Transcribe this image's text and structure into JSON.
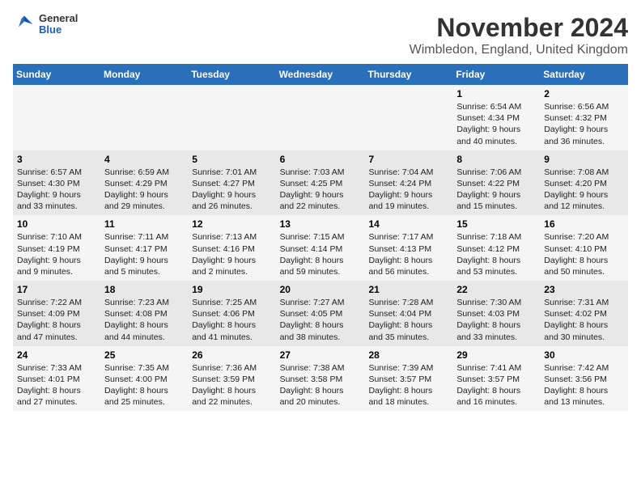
{
  "header": {
    "logo_general": "General",
    "logo_blue": "Blue",
    "title": "November 2024",
    "location": "Wimbledon, England, United Kingdom"
  },
  "weekdays": [
    "Sunday",
    "Monday",
    "Tuesday",
    "Wednesday",
    "Thursday",
    "Friday",
    "Saturday"
  ],
  "weeks": [
    [
      {
        "day": "",
        "info": ""
      },
      {
        "day": "",
        "info": ""
      },
      {
        "day": "",
        "info": ""
      },
      {
        "day": "",
        "info": ""
      },
      {
        "day": "",
        "info": ""
      },
      {
        "day": "1",
        "info": "Sunrise: 6:54 AM\nSunset: 4:34 PM\nDaylight: 9 hours\nand 40 minutes."
      },
      {
        "day": "2",
        "info": "Sunrise: 6:56 AM\nSunset: 4:32 PM\nDaylight: 9 hours\nand 36 minutes."
      }
    ],
    [
      {
        "day": "3",
        "info": "Sunrise: 6:57 AM\nSunset: 4:30 PM\nDaylight: 9 hours\nand 33 minutes."
      },
      {
        "day": "4",
        "info": "Sunrise: 6:59 AM\nSunset: 4:29 PM\nDaylight: 9 hours\nand 29 minutes."
      },
      {
        "day": "5",
        "info": "Sunrise: 7:01 AM\nSunset: 4:27 PM\nDaylight: 9 hours\nand 26 minutes."
      },
      {
        "day": "6",
        "info": "Sunrise: 7:03 AM\nSunset: 4:25 PM\nDaylight: 9 hours\nand 22 minutes."
      },
      {
        "day": "7",
        "info": "Sunrise: 7:04 AM\nSunset: 4:24 PM\nDaylight: 9 hours\nand 19 minutes."
      },
      {
        "day": "8",
        "info": "Sunrise: 7:06 AM\nSunset: 4:22 PM\nDaylight: 9 hours\nand 15 minutes."
      },
      {
        "day": "9",
        "info": "Sunrise: 7:08 AM\nSunset: 4:20 PM\nDaylight: 9 hours\nand 12 minutes."
      }
    ],
    [
      {
        "day": "10",
        "info": "Sunrise: 7:10 AM\nSunset: 4:19 PM\nDaylight: 9 hours\nand 9 minutes."
      },
      {
        "day": "11",
        "info": "Sunrise: 7:11 AM\nSunset: 4:17 PM\nDaylight: 9 hours\nand 5 minutes."
      },
      {
        "day": "12",
        "info": "Sunrise: 7:13 AM\nSunset: 4:16 PM\nDaylight: 9 hours\nand 2 minutes."
      },
      {
        "day": "13",
        "info": "Sunrise: 7:15 AM\nSunset: 4:14 PM\nDaylight: 8 hours\nand 59 minutes."
      },
      {
        "day": "14",
        "info": "Sunrise: 7:17 AM\nSunset: 4:13 PM\nDaylight: 8 hours\nand 56 minutes."
      },
      {
        "day": "15",
        "info": "Sunrise: 7:18 AM\nSunset: 4:12 PM\nDaylight: 8 hours\nand 53 minutes."
      },
      {
        "day": "16",
        "info": "Sunrise: 7:20 AM\nSunset: 4:10 PM\nDaylight: 8 hours\nand 50 minutes."
      }
    ],
    [
      {
        "day": "17",
        "info": "Sunrise: 7:22 AM\nSunset: 4:09 PM\nDaylight: 8 hours\nand 47 minutes."
      },
      {
        "day": "18",
        "info": "Sunrise: 7:23 AM\nSunset: 4:08 PM\nDaylight: 8 hours\nand 44 minutes."
      },
      {
        "day": "19",
        "info": "Sunrise: 7:25 AM\nSunset: 4:06 PM\nDaylight: 8 hours\nand 41 minutes."
      },
      {
        "day": "20",
        "info": "Sunrise: 7:27 AM\nSunset: 4:05 PM\nDaylight: 8 hours\nand 38 minutes."
      },
      {
        "day": "21",
        "info": "Sunrise: 7:28 AM\nSunset: 4:04 PM\nDaylight: 8 hours\nand 35 minutes."
      },
      {
        "day": "22",
        "info": "Sunrise: 7:30 AM\nSunset: 4:03 PM\nDaylight: 8 hours\nand 33 minutes."
      },
      {
        "day": "23",
        "info": "Sunrise: 7:31 AM\nSunset: 4:02 PM\nDaylight: 8 hours\nand 30 minutes."
      }
    ],
    [
      {
        "day": "24",
        "info": "Sunrise: 7:33 AM\nSunset: 4:01 PM\nDaylight: 8 hours\nand 27 minutes."
      },
      {
        "day": "25",
        "info": "Sunrise: 7:35 AM\nSunset: 4:00 PM\nDaylight: 8 hours\nand 25 minutes."
      },
      {
        "day": "26",
        "info": "Sunrise: 7:36 AM\nSunset: 3:59 PM\nDaylight: 8 hours\nand 22 minutes."
      },
      {
        "day": "27",
        "info": "Sunrise: 7:38 AM\nSunset: 3:58 PM\nDaylight: 8 hours\nand 20 minutes."
      },
      {
        "day": "28",
        "info": "Sunrise: 7:39 AM\nSunset: 3:57 PM\nDaylight: 8 hours\nand 18 minutes."
      },
      {
        "day": "29",
        "info": "Sunrise: 7:41 AM\nSunset: 3:57 PM\nDaylight: 8 hours\nand 16 minutes."
      },
      {
        "day": "30",
        "info": "Sunrise: 7:42 AM\nSunset: 3:56 PM\nDaylight: 8 hours\nand 13 minutes."
      }
    ]
  ]
}
